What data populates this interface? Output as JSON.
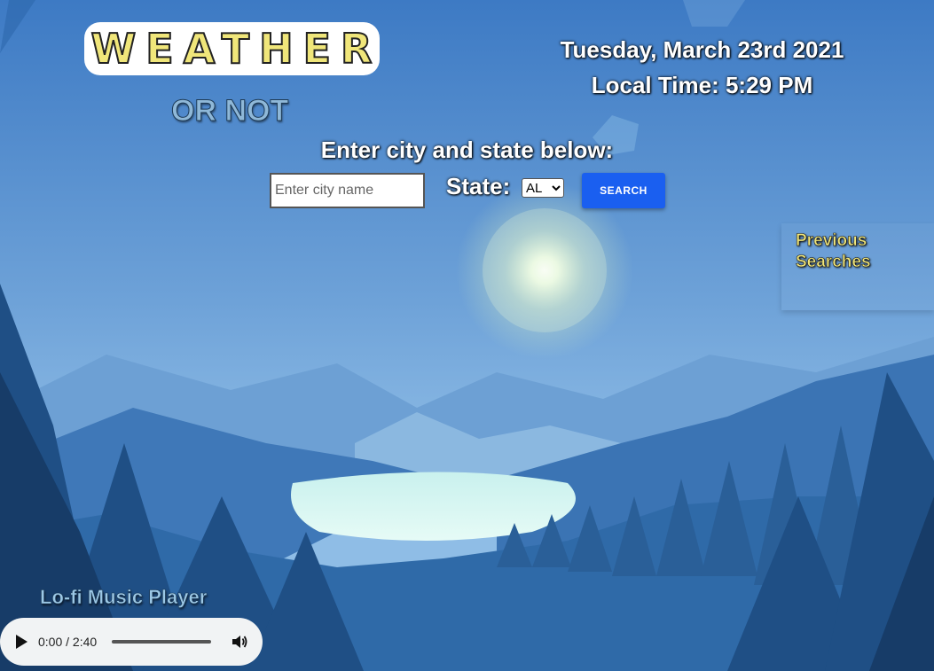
{
  "app": {
    "title": "WEATHER",
    "subtitle": "OR NOT"
  },
  "header": {
    "date": "Tuesday, March 23rd 2021",
    "time": "Local Time: 5:29 PM"
  },
  "search": {
    "prompt": "Enter city and state below:",
    "city_placeholder": "Enter city name",
    "state_label": "State:",
    "state_selected": "AL",
    "button_label": "SEARCH"
  },
  "history": {
    "title": "Previous Searches"
  },
  "music": {
    "title": "Lo-fi Music Player",
    "time_display": "0:00 / 2:40",
    "progress": 0
  },
  "colors": {
    "title_fill": "#f0e67a",
    "search_button": "#1a5ff0",
    "history_title": "#f0e67a",
    "music_title": "#9cc8e6"
  },
  "icons": {
    "play": "play-icon",
    "volume": "volume-icon"
  }
}
